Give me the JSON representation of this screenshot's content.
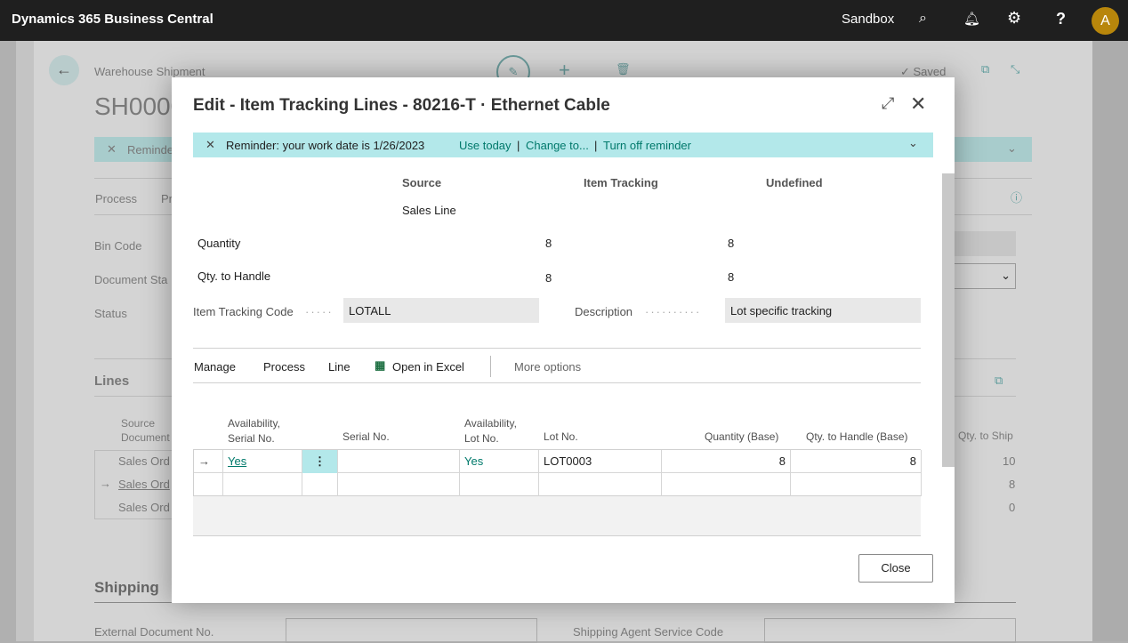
{
  "app": {
    "title": "Dynamics 365 Business Central",
    "environment": "Sandbox",
    "avatar": "A",
    "avatar_color": "#b8860b"
  },
  "background": {
    "breadcrumb": "Warehouse Shipment",
    "doc_no": "SH0000",
    "saved": "Saved",
    "reminder": "Reminder",
    "tabs": [
      "Process",
      "Pr"
    ],
    "fields": [
      "Bin Code",
      "Document Sta",
      "Status"
    ],
    "lines_title": "Lines",
    "col_source": [
      "Source",
      "Document"
    ],
    "col_qty_ship": "Qty. to Ship",
    "rows": [
      {
        "doc": "Sales Ord",
        "qty": "10"
      },
      {
        "doc": "Sales Ord",
        "qty": "8"
      },
      {
        "doc": "Sales Ord",
        "qty": "0"
      }
    ],
    "shipping": "Shipping",
    "ext_doc": "External Document No.",
    "agent_service": "Shipping Agent Service Code"
  },
  "modal": {
    "title": "Edit - Item Tracking Lines - 80216-T · Ethernet Cable",
    "reminder": {
      "text": "Reminder: your work date is 1/26/2023",
      "use_today": "Use today",
      "change_to": "Change to...",
      "turn_off": "Turn off reminder"
    },
    "summary": {
      "col_source": "Source",
      "col_item_tracking": "Item Tracking",
      "col_undefined": "Undefined",
      "source_sub": "Sales Line",
      "rows": [
        {
          "label": "Quantity",
          "source": "8",
          "undefined": "8"
        },
        {
          "label": "Qty. to Handle",
          "source": "8",
          "undefined": "8"
        }
      ]
    },
    "item_tracking_code_label": "Item Tracking Code",
    "item_tracking_code": "LOTALL",
    "description_label": "Description",
    "description": "Lot specific tracking",
    "actions": [
      "Manage",
      "Process",
      "Line",
      "Open in Excel",
      "More options"
    ],
    "columns": {
      "avail_serial": [
        "Availability,",
        "Serial No."
      ],
      "serial": "Serial No.",
      "avail_lot": [
        "Availability,",
        "Lot No."
      ],
      "lot": "Lot No.",
      "qty_base": "Quantity (Base)",
      "qty_handle": "Qty. to Handle (Base)"
    },
    "lines": [
      {
        "avail_serial": "Yes",
        "serial": "",
        "avail_lot": "Yes",
        "lot": "LOT0003",
        "qty_base": "8",
        "qty_handle": "8"
      }
    ],
    "close": "Close"
  }
}
